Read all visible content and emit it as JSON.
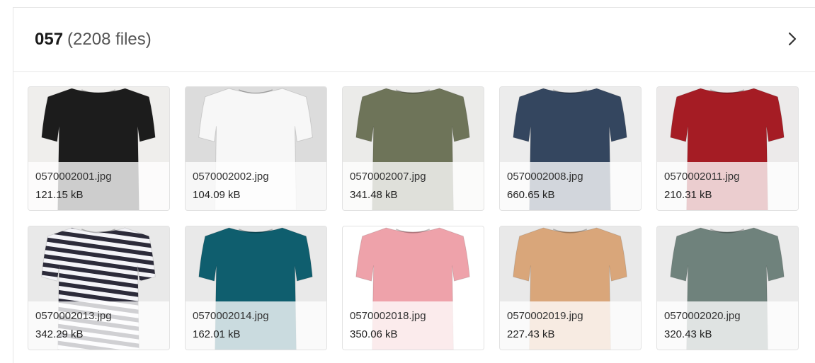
{
  "folder": {
    "name": "057",
    "count_label": "(2208 files)"
  },
  "files": [
    {
      "name": "0570002001.jpg",
      "size": "121.15 kB",
      "color": "#1c1c1c",
      "bg": "#efeeec",
      "pattern": "solid"
    },
    {
      "name": "0570002002.jpg",
      "size": "104.09 kB",
      "color": "#f7f7f7",
      "bg": "#dcdcdc",
      "pattern": "solid"
    },
    {
      "name": "0570002007.jpg",
      "size": "341.48 kB",
      "color": "#6e7459",
      "bg": "#ebebe9",
      "pattern": "solid"
    },
    {
      "name": "0570002008.jpg",
      "size": "660.65 kB",
      "color": "#34465f",
      "bg": "#ececec",
      "pattern": "solid"
    },
    {
      "name": "0570002011.jpg",
      "size": "210.31 kB",
      "color": "#a51c24",
      "bg": "#eceaea",
      "pattern": "solid"
    },
    {
      "name": "0570002013.jpg",
      "size": "342.29 kB",
      "color": "#2c2b3a",
      "bg": "#e9e9e9",
      "pattern": "stripes"
    },
    {
      "name": "0570002014.jpg",
      "size": "162.01 kB",
      "color": "#0f5e6e",
      "bg": "#e9e9e9",
      "pattern": "solid"
    },
    {
      "name": "0570002018.jpg",
      "size": "350.06 kB",
      "color": "#eea2aa",
      "bg": "#ffffff",
      "pattern": "solid"
    },
    {
      "name": "0570002019.jpg",
      "size": "227.43 kB",
      "color": "#d9a67a",
      "bg": "#e9e9e9",
      "pattern": "solid"
    },
    {
      "name": "0570002020.jpg",
      "size": "320.43 kB",
      "color": "#6f827c",
      "bg": "#ebebeb",
      "pattern": "solid"
    }
  ],
  "icons": {
    "next": "chevron-right-icon",
    "thumbnail": "tshirt-icon"
  }
}
